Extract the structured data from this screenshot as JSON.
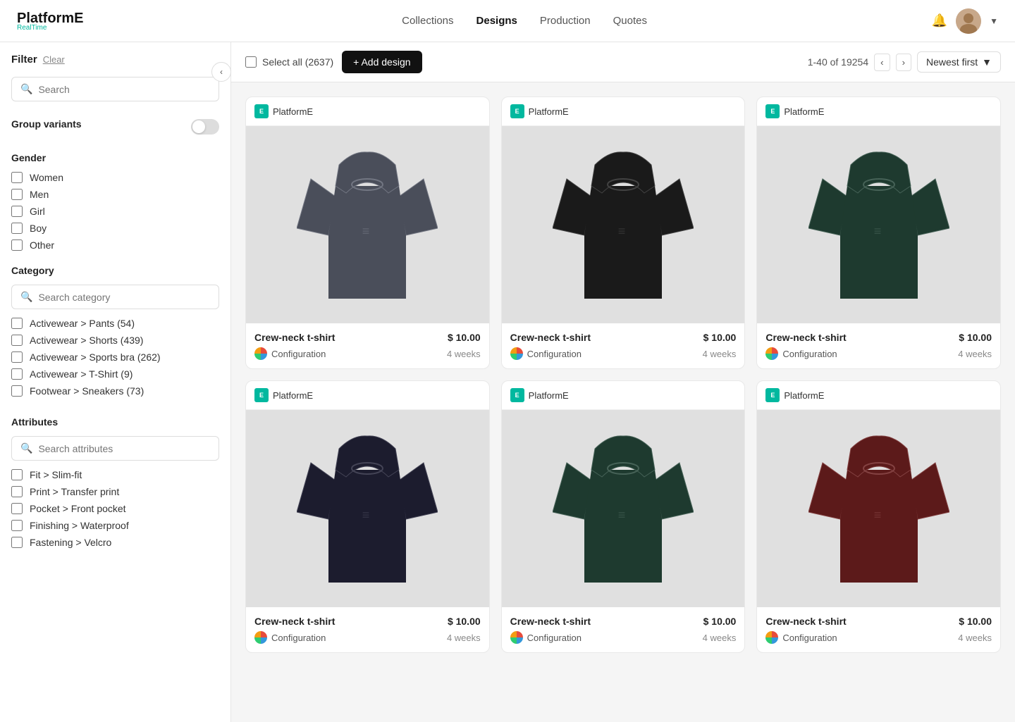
{
  "logo": {
    "text": "PlatformE",
    "accent": "RealTime"
  },
  "nav": {
    "links": [
      {
        "id": "collections",
        "label": "Collections",
        "active": false
      },
      {
        "id": "designs",
        "label": "Designs",
        "active": true
      },
      {
        "id": "production",
        "label": "Production",
        "active": false
      },
      {
        "id": "quotes",
        "label": "Quotes",
        "active": false
      }
    ]
  },
  "toolbar": {
    "select_all_label": "Select all (2637)",
    "add_design_label": "+ Add design",
    "pagination_info": "1-40 of 19254",
    "sort_label": "Newest first"
  },
  "sidebar": {
    "filter_title": "Filter",
    "clear_label": "Clear",
    "search_placeholder": "Search",
    "group_variants_label": "Group variants",
    "gender_title": "Gender",
    "gender_options": [
      "Women",
      "Men",
      "Girl",
      "Boy",
      "Other"
    ],
    "category_title": "Category",
    "category_search_placeholder": "Search category",
    "category_options": [
      "Activewear > Pants (54)",
      "Activewear > Shorts (439)",
      "Activewear > Sports bra (262)",
      "Activewear > T-Shirt (9)",
      "Footwear > Sneakers (73)"
    ],
    "attributes_title": "Attributes",
    "attributes_search_placeholder": "Search attributes",
    "attribute_options": [
      "Fit > Slim-fit",
      "Print > Transfer print",
      "Pocket > Front pocket",
      "Finishing > Waterproof",
      "Fastening > Velcro"
    ]
  },
  "designs": [
    {
      "brand": "PlatformE",
      "name": "Crew-neck t-shirt",
      "price": "$ 10.00",
      "config": "Configuration",
      "weeks": "4 weeks",
      "color": "#4a4e5a"
    },
    {
      "brand": "PlatformE",
      "name": "Crew-neck t-shirt",
      "price": "$ 10.00",
      "config": "Configuration",
      "weeks": "4 weeks",
      "color": "#1a1a1a"
    },
    {
      "brand": "PlatformE",
      "name": "Crew-neck t-shirt",
      "price": "$ 10.00",
      "config": "Configuration",
      "weeks": "4 weeks",
      "color": "#1e3a2f"
    },
    {
      "brand": "PlatformE",
      "name": "Crew-neck t-shirt",
      "price": "$ 10.00",
      "config": "Configuration",
      "weeks": "4 weeks",
      "color": "#1c1c2e"
    },
    {
      "brand": "PlatformE",
      "name": "Crew-neck t-shirt",
      "price": "$ 10.00",
      "config": "Configuration",
      "weeks": "4 weeks",
      "color": "#1e3a2f"
    },
    {
      "brand": "PlatformE",
      "name": "Crew-neck t-shirt",
      "price": "$ 10.00",
      "config": "Configuration",
      "weeks": "4 weeks",
      "color": "#5c1a1a"
    }
  ]
}
